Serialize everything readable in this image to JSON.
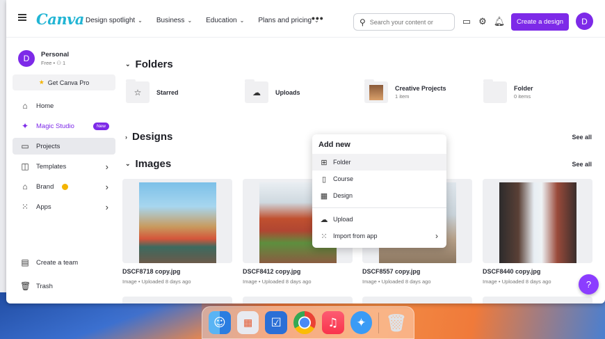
{
  "topbar": {
    "logo": "Canva",
    "nav": [
      "Design spotlight",
      "Business",
      "Education",
      "Plans and pricing"
    ],
    "more": "•••",
    "search_placeholder": "Search your content or",
    "create_label": "Create a design",
    "avatar_initial": "D"
  },
  "sidebar": {
    "account_name": "Personal",
    "account_plan": "Free • ",
    "account_members": "1",
    "pro_label": "Get Canva Pro",
    "items": [
      {
        "label": "Home",
        "icon": "home-icon"
      },
      {
        "label": "Magic Studio",
        "icon": "sparkle-icon",
        "badge": "New"
      },
      {
        "label": "Projects",
        "icon": "folder-icon"
      },
      {
        "label": "Templates",
        "icon": "template-icon"
      },
      {
        "label": "Brand",
        "icon": "brand-icon"
      },
      {
        "label": "Apps",
        "icon": "apps-icon"
      }
    ],
    "create_team": "Create a team",
    "trash": "Trash"
  },
  "main": {
    "folders_heading": "Folders",
    "folders": [
      {
        "name": "Starred",
        "sub": ""
      },
      {
        "name": "Uploads",
        "sub": ""
      },
      {
        "name": "Creative Projects",
        "sub": "1 item"
      },
      {
        "name": "Folder",
        "sub": "0 items"
      }
    ],
    "designs_heading": "Designs",
    "images_heading": "Images",
    "see_all": "See all",
    "images": [
      {
        "name": "DSCF8718 copy.jpg",
        "sub": "Image • Uploaded 8 days ago"
      },
      {
        "name": "DSCF8412 copy.jpg",
        "sub": "Image • Uploaded 8 days ago"
      },
      {
        "name": "DSCF8557 copy.jpg",
        "sub": "Image • Uploaded 8 days ago"
      },
      {
        "name": "DSCF8440 copy.jpg",
        "sub": "Image • Uploaded 8 days ago"
      }
    ]
  },
  "popup": {
    "title": "Add new",
    "items": [
      "Folder",
      "Course",
      "Design",
      "Upload",
      "Import from app"
    ]
  },
  "help_label": "?",
  "colors": {
    "accent": "#7d2ae8",
    "logo": "#22b5d4"
  }
}
